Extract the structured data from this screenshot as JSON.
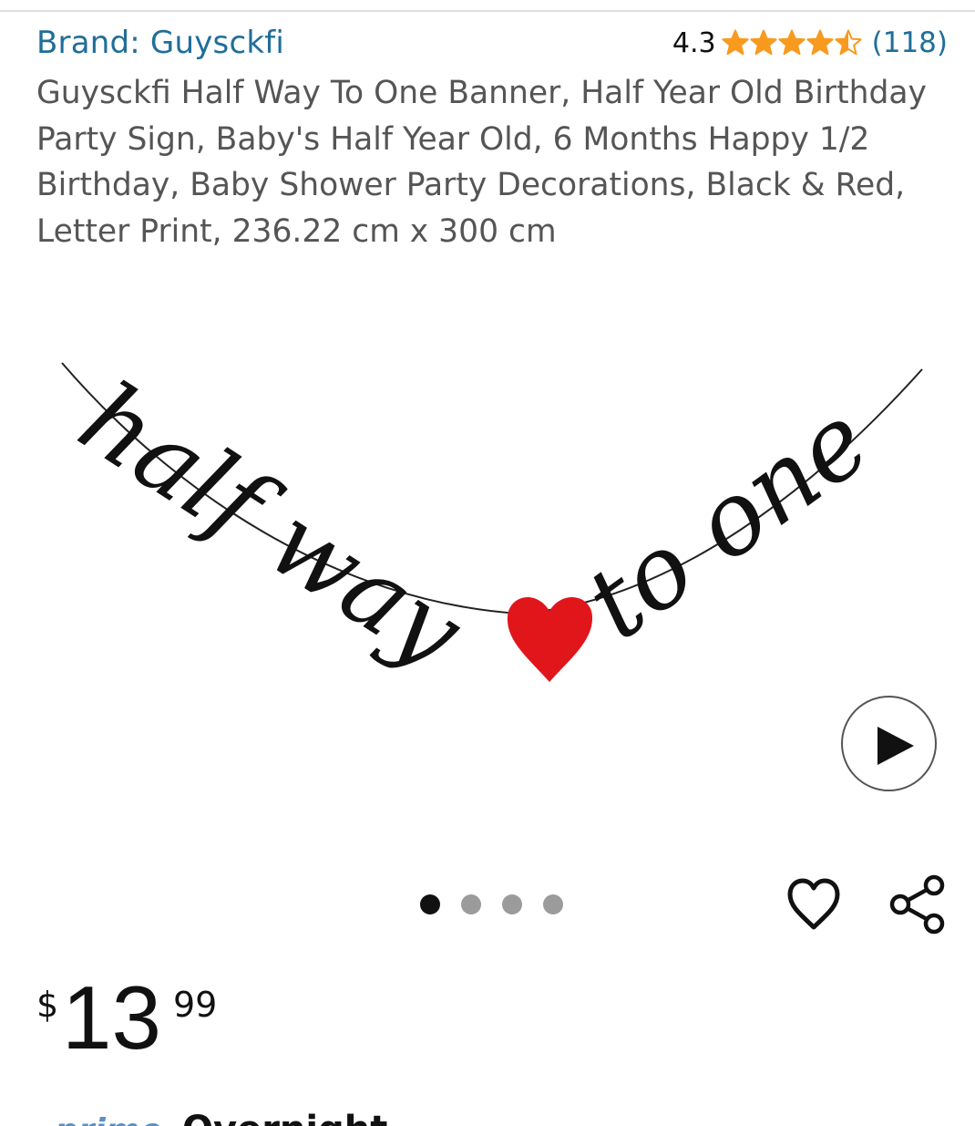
{
  "brand": {
    "label": "Brand: Guysckfi"
  },
  "rating": {
    "value": "4.3",
    "stars": 4.3,
    "count": "(118)",
    "star_color": "#f79a1f"
  },
  "product": {
    "title": "Guysckfi Half Way To One Banner, Half Year Old Birthday Party Sign, Baby's Half Year Old, 6 Months Happy 1/2 Birthday, Baby Shower Party Decorations, Black & Red, Letter Print, 236.22 cm x 300 cm",
    "image": {
      "banner_text_left": "half way",
      "banner_text_right": "to one",
      "heart_color": "#e0161b",
      "letter_color": "#111111"
    }
  },
  "media": {
    "play_icon": "play-icon",
    "carousel": {
      "total": 4,
      "active": 1
    }
  },
  "actions": {
    "wishlist_icon": "heart-outline-icon",
    "share_icon": "share-icon"
  },
  "price": {
    "symbol": "$",
    "whole": "13",
    "fraction": "99"
  },
  "delivery": {
    "prime": "prime",
    "label": "Overnight"
  },
  "colors": {
    "link": "#1f6e99",
    "text_secondary": "#555555",
    "dot_inactive": "#9b9b9b",
    "dot_active": "#111111"
  }
}
